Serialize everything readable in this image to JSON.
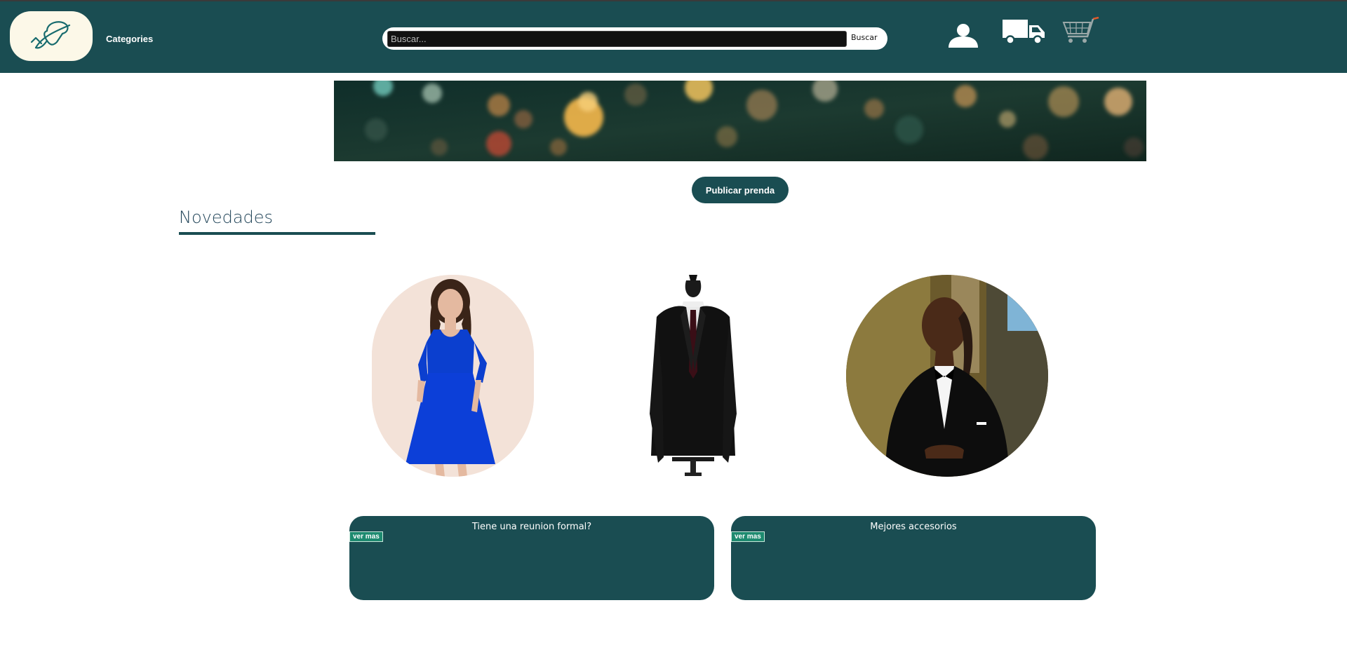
{
  "header": {
    "categories_label": "Categories",
    "search": {
      "placeholder": "Buscar...",
      "value": "",
      "button_label": "Buscar"
    },
    "icons": [
      "user-icon",
      "truck-icon",
      "cart-icon"
    ]
  },
  "main": {
    "publish_button": "Publicar prenda",
    "section_title": "Novedades",
    "products": [
      "blue-dress-photo",
      "black-suit-photo",
      "man-tuxedo-photo"
    ],
    "cards": [
      {
        "title": "Tiene una reunion formal?",
        "button": "ver mas"
      },
      {
        "title": "Mejores accesorios",
        "button": "ver mas"
      }
    ]
  },
  "colors": {
    "primary": "#1a4d52",
    "logo_bg": "#fcf8e8",
    "card_button": "#1d8a6f"
  }
}
